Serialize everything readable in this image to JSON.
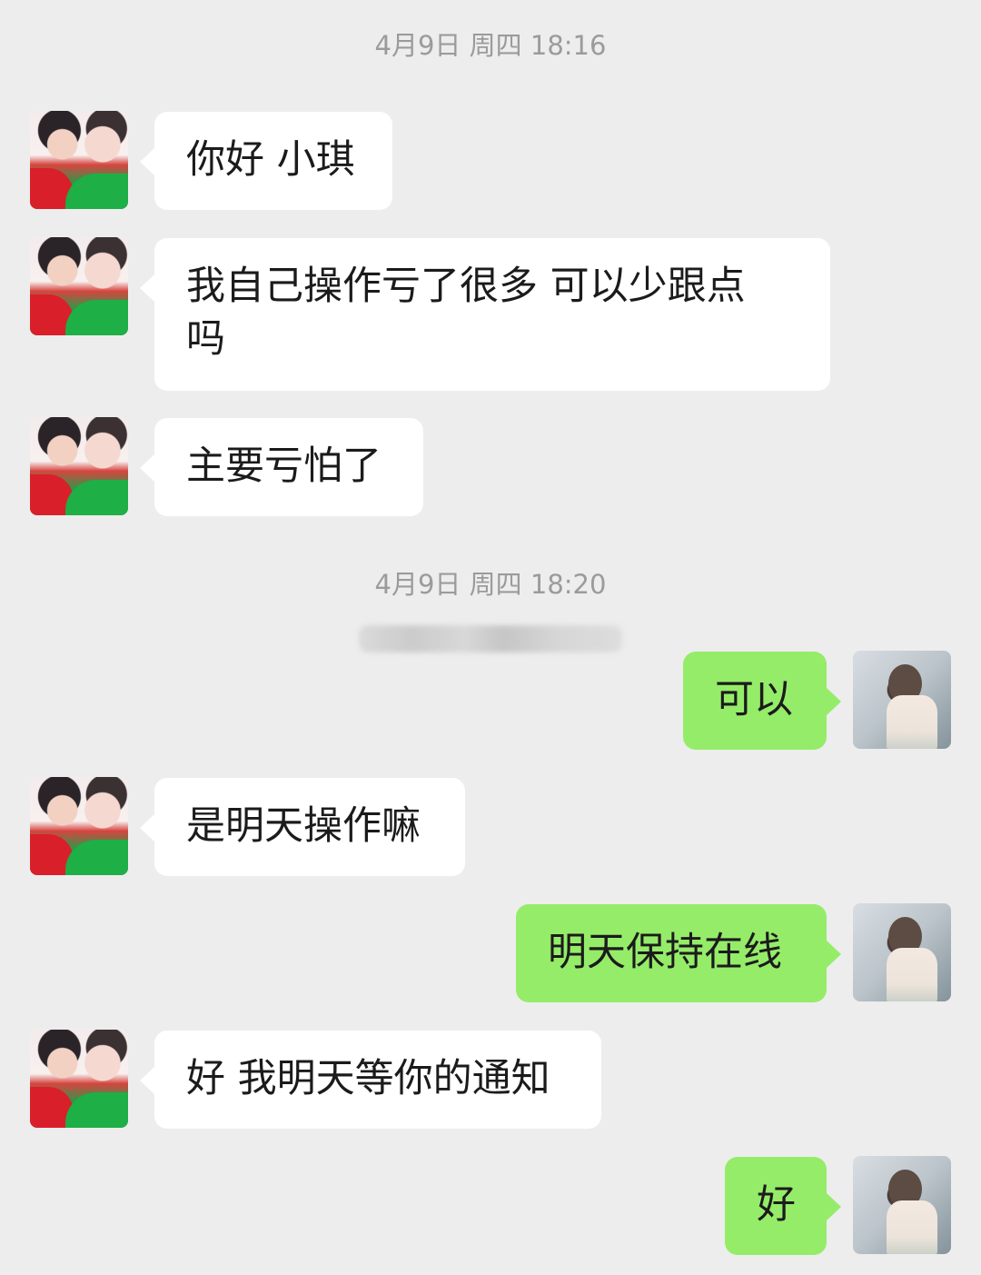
{
  "chat": {
    "timestamps": [
      "4月9日 周四 18:16",
      "4月9日 周四 18:20"
    ],
    "messages": [
      {
        "sender": "other",
        "text": "你好 小琪"
      },
      {
        "sender": "other",
        "text": "我自己操作亏了很多 可以少跟点\n吗"
      },
      {
        "sender": "other",
        "text": "主要亏怕了"
      },
      {
        "sender": "self",
        "text": "可以"
      },
      {
        "sender": "other",
        "text": "是明天操作嘛"
      },
      {
        "sender": "self",
        "text": "明天保持在线"
      },
      {
        "sender": "other",
        "text": "好 我明天等你的通知"
      },
      {
        "sender": "self",
        "text": "好"
      }
    ]
  },
  "colors": {
    "background": "#ededed",
    "incoming_bubble": "#ffffff",
    "outgoing_bubble": "#95ec69",
    "timestamp_text": "#9b9b9b"
  },
  "icons": {
    "avatar_other": "avatar-other-icon",
    "avatar_self": "avatar-self-icon"
  }
}
